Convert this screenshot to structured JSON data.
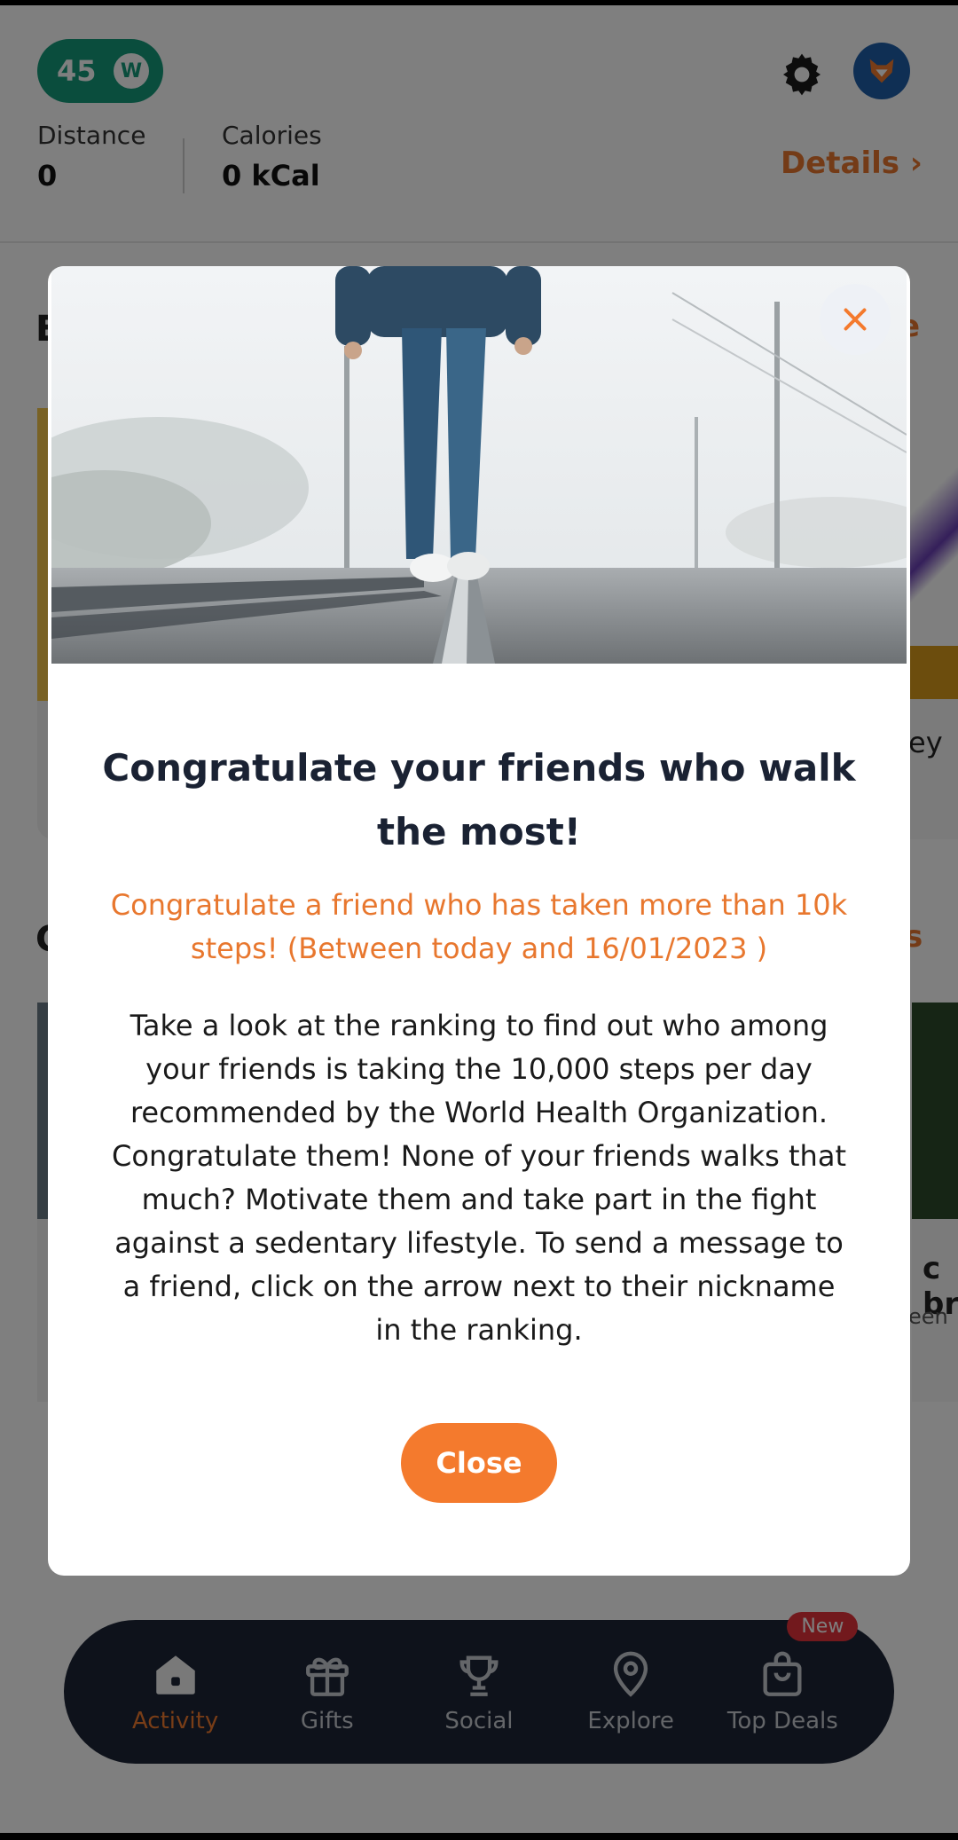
{
  "header": {
    "points": "45",
    "coin_letter": "W",
    "stats": [
      {
        "label": "Distance",
        "value": "0"
      },
      {
        "label": "Calories",
        "value": "0 kCal"
      }
    ],
    "details_label": "Details ›"
  },
  "background": {
    "section1_letter": "E",
    "section1_link": "e",
    "section2_letter": "C",
    "section2_link": "s",
    "card_text_1": "ey",
    "card_text_2": "c br",
    "card_text_3": "een"
  },
  "modal": {
    "title": "Congratulate your friends who walk the most!",
    "subtitle": "Congratulate a friend who has taken more than 10k steps! (Between today and 16/01/2023 )",
    "body": "Take a look at the ranking to find out who among your friends is taking the 10,000 steps per day recommended by the World Health Organization. Congratulate them! None of your friends walks that much? Motivate them and take part in the fight against a sedentary lifestyle. To send a message to a friend, click on the arrow next to their nickname in the ranking.",
    "close_button": "Close"
  },
  "nav": {
    "items": [
      {
        "label": "Activity",
        "icon": "home-icon",
        "active": true
      },
      {
        "label": "Gifts",
        "icon": "gift-icon"
      },
      {
        "label": "Social",
        "icon": "trophy-icon"
      },
      {
        "label": "Explore",
        "icon": "location-pin-icon"
      },
      {
        "label": "Top Deals",
        "icon": "shopping-bag-icon",
        "badge": "New"
      }
    ]
  },
  "colors": {
    "accent": "#f47a2d",
    "points_green": "#149a7a",
    "nav_bg": "#1c2436"
  }
}
